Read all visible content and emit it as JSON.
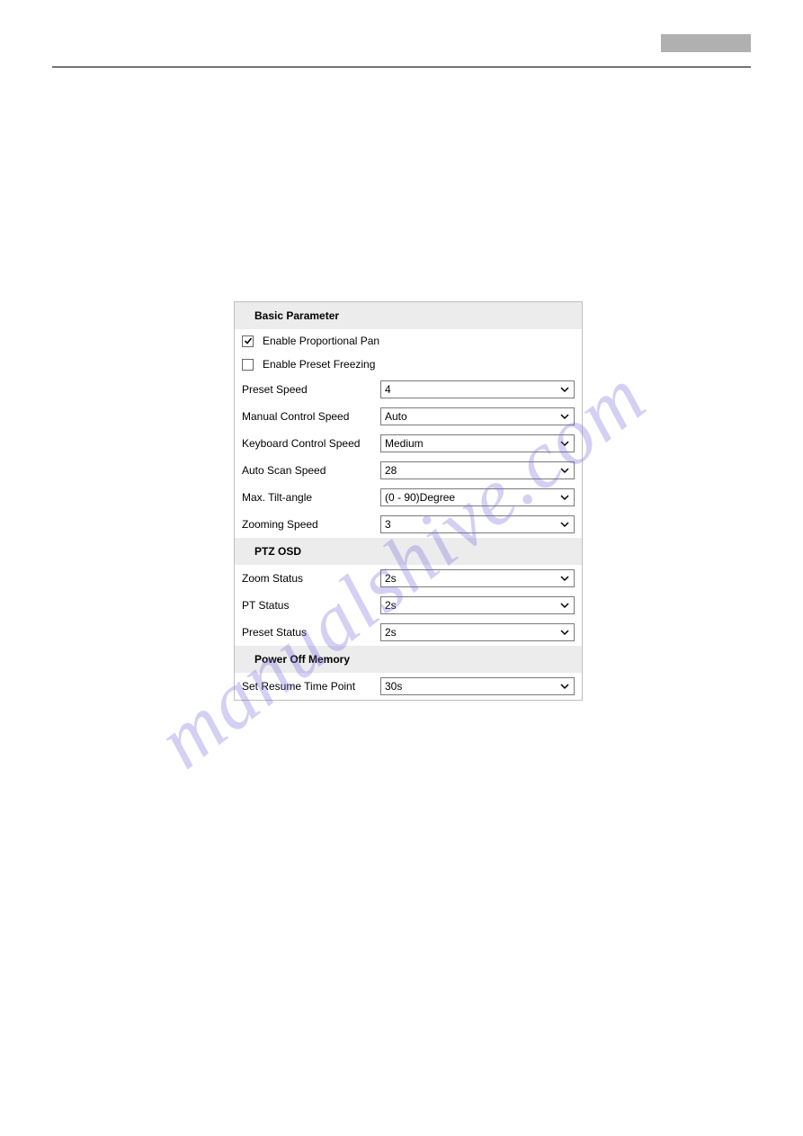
{
  "watermark": "manualshive.com",
  "sections": {
    "basic": {
      "title": "Basic Parameter",
      "enable_proportional_pan": {
        "label": "Enable Proportional Pan",
        "checked": true
      },
      "enable_preset_freezing": {
        "label": "Enable Preset Freezing",
        "checked": false
      },
      "preset_speed": {
        "label": "Preset Speed",
        "value": "4"
      },
      "manual_control_speed": {
        "label": "Manual Control Speed",
        "value": "Auto"
      },
      "keyboard_control_speed": {
        "label": "Keyboard Control Speed",
        "value": "Medium"
      },
      "auto_scan_speed": {
        "label": "Auto Scan Speed",
        "value": "28"
      },
      "max_tilt_angle": {
        "label": "Max. Tilt-angle",
        "value": "(0 - 90)Degree"
      },
      "zooming_speed": {
        "label": "Zooming Speed",
        "value": "3"
      }
    },
    "ptz_osd": {
      "title": "PTZ OSD",
      "zoom_status": {
        "label": "Zoom Status",
        "value": "2s"
      },
      "pt_status": {
        "label": "PT Status",
        "value": "2s"
      },
      "preset_status": {
        "label": "Preset Status",
        "value": "2s"
      }
    },
    "power_off": {
      "title": "Power Off Memory",
      "set_resume_time_point": {
        "label": "Set Resume Time Point",
        "value": "30s"
      }
    }
  }
}
